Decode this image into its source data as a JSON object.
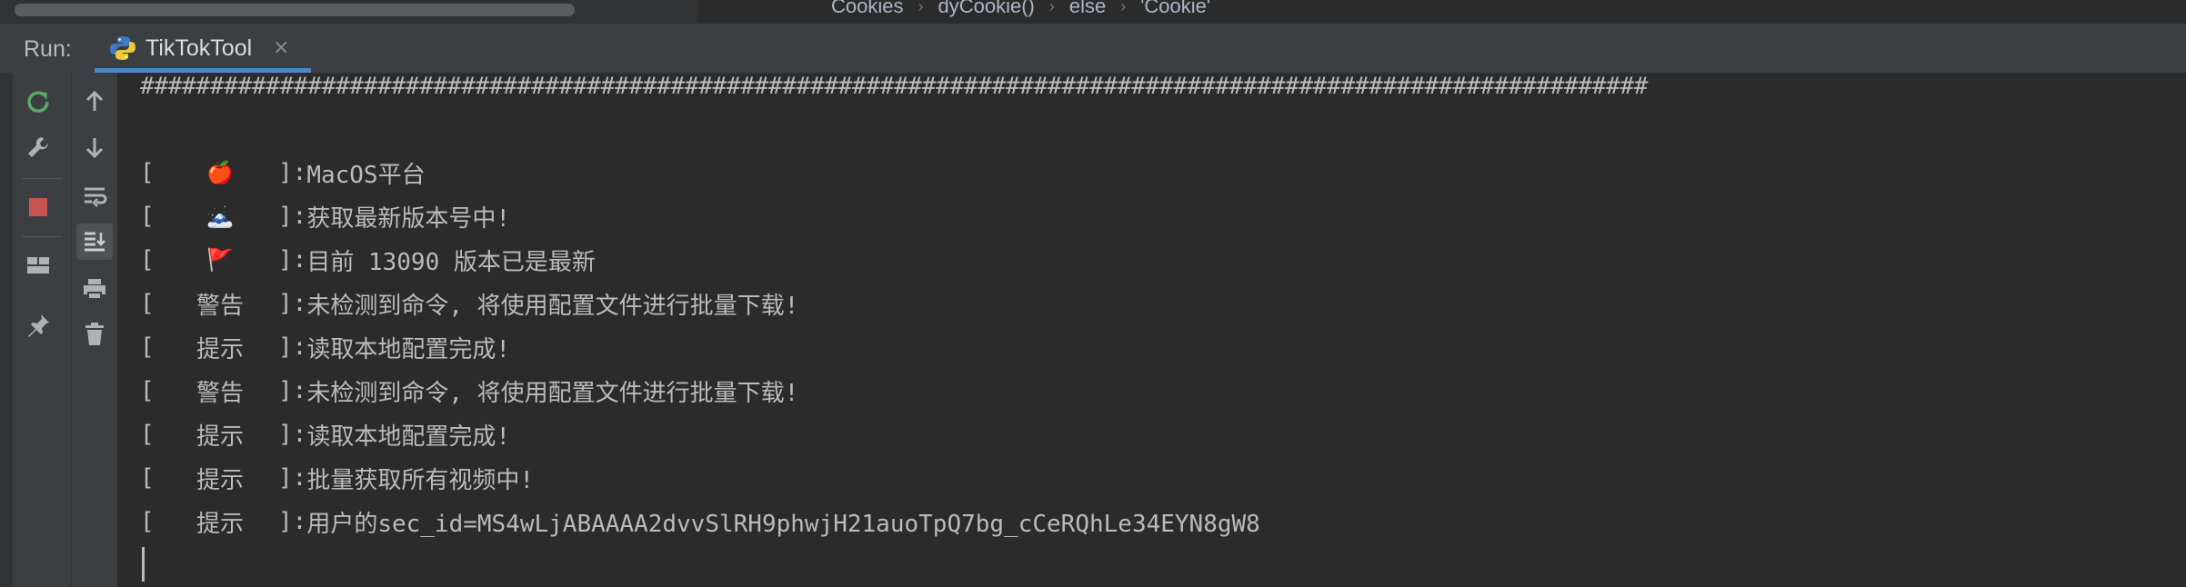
{
  "breadcrumb": {
    "items": [
      "Cookies",
      "dyCookie()",
      "else",
      "'Cookie'"
    ],
    "separator": "›"
  },
  "run_panel": {
    "label": "Run:",
    "tab": {
      "title": "TikTokTool",
      "icon": "python-icon",
      "close": "×"
    }
  },
  "toolbar": {
    "col1": [
      "rerun-icon",
      "wrench-icon",
      "stop-icon",
      "layout-icon",
      "pin-icon"
    ],
    "col2": [
      "arrow-up-icon",
      "arrow-down-icon",
      "soft-wrap-icon",
      "scroll-to-end-icon",
      "print-icon",
      "trash-icon"
    ]
  },
  "console": {
    "separator": "############################################################################################################",
    "lines": [
      {
        "tag": "🍎",
        "message": "MacOS平台"
      },
      {
        "tag": "🗻",
        "message": "获取最新版本号中!"
      },
      {
        "tag": "🚩",
        "message": "目前 13090 版本已是最新"
      },
      {
        "tag": "警告",
        "message": "未检测到命令, 将使用配置文件进行批量下载!"
      },
      {
        "tag": "提示",
        "message": "读取本地配置完成!"
      },
      {
        "tag": "警告",
        "message": "未检测到命令, 将使用配置文件进行批量下载!"
      },
      {
        "tag": "提示",
        "message": "读取本地配置完成!"
      },
      {
        "tag": "提示",
        "message": "批量获取所有视频中!"
      },
      {
        "tag": "提示",
        "message": "用户的sec_id=MS4wLjABAAAA2dvvSlRH9phwjH21auoTpQ7bg_cCeRQhLe34EYN8gW8"
      }
    ],
    "bracket_open": "[",
    "bracket_close": "]:"
  },
  "colors": {
    "background": "#2b2b2b",
    "panel": "#3c3f41",
    "text": "#bbbbbb",
    "accent": "#4a88c7",
    "stop": "#c75450",
    "rerun": "#59a869"
  }
}
